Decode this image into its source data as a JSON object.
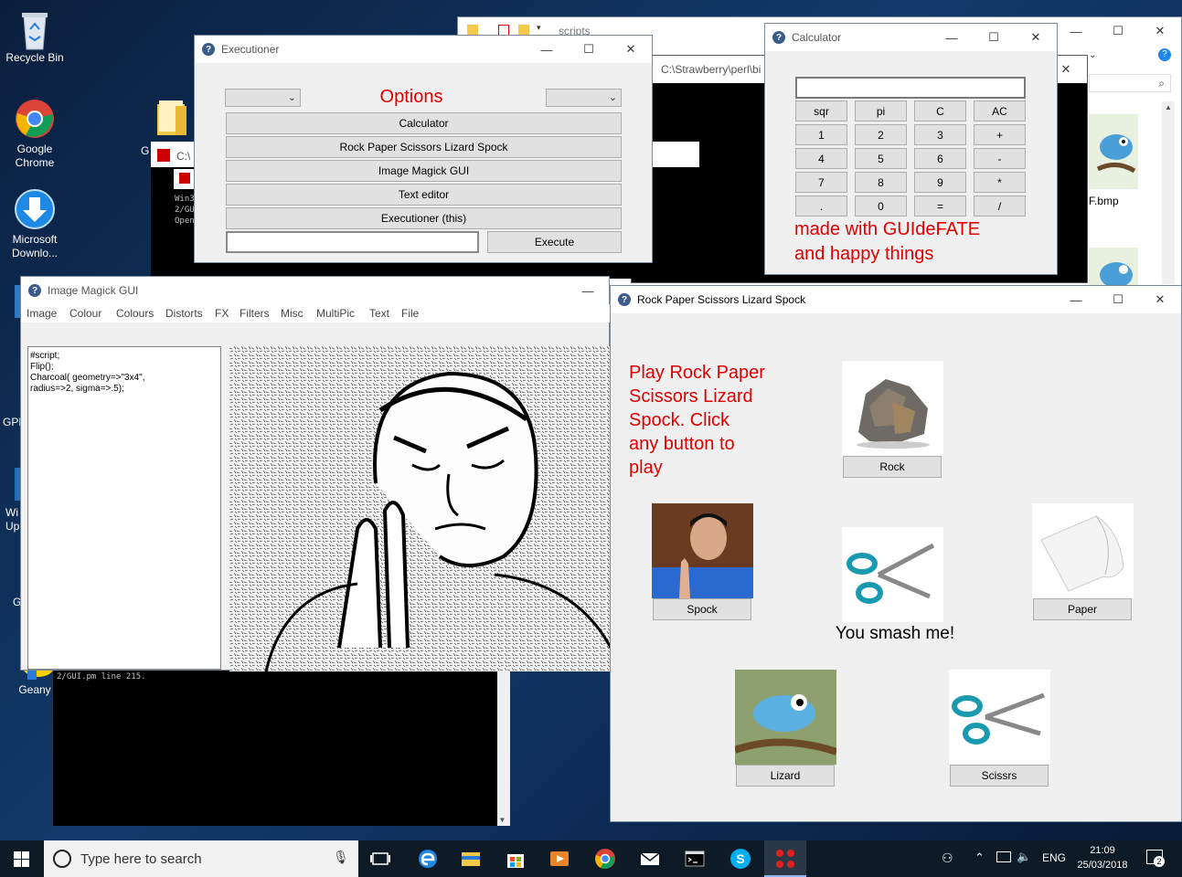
{
  "desktop": {
    "icons": [
      {
        "label": "Recycle Bin",
        "icon": "recycle-bin-icon"
      },
      {
        "label": "Google Chrome",
        "icon": "chrome-icon"
      },
      {
        "label": "Microsoft Downlo...",
        "icon": "download-arrow-icon"
      },
      {
        "label": "Geany",
        "icon": "geany-icon"
      }
    ],
    "partial_labels": [
      "G",
      "GPL",
      "Wi",
      "Up",
      "G"
    ]
  },
  "explorer": {
    "title": "scripts",
    "file1": "F.bmp"
  },
  "console_back": {
    "title": "C:\\Strawberry\\perl\\bi",
    "title2": "C:\\",
    "lines": [
      "Win3",
      "2/GU",
      "Open"
    ],
    "bottom_line": "2/GUI.pm line 215."
  },
  "executioner": {
    "title": "Executioner",
    "heading": "Options",
    "buttons": [
      "Calculator",
      "Rock Paper Scissors Lizard Spock",
      "Image Magick GUI",
      "Text editor",
      "Executioner (this)"
    ],
    "execute_label": "Execute",
    "command_value": ""
  },
  "calculator": {
    "title": "Calculator",
    "display": "",
    "keys": [
      "sqr",
      "pi",
      "C",
      "AC",
      "1",
      "2",
      "3",
      "+",
      "4",
      "5",
      "6",
      "-",
      "7",
      "8",
      "9",
      "*",
      ".",
      "0",
      "=",
      "/"
    ],
    "footer_line1": "made with GUIdeFATE",
    "footer_line2": "and happy things"
  },
  "imagemagick": {
    "title": "Image Magick GUI",
    "menu": [
      "Image",
      "Colour",
      "Colours",
      "Distorts",
      "FX",
      "Filters",
      "Misc",
      "MultiPic",
      "Text",
      "File"
    ],
    "script_lines": [
      "#script;",
      "Flip();",
      "Charcoal( geometry=>\"3x4\",",
      "radius=>2, sigma=>.5);"
    ]
  },
  "rpsls": {
    "title": "Rock Paper Scissors Lizard Spock",
    "intro_lines": [
      "Play Rock Paper",
      "Scissors Lizard",
      "Spock.  Click",
      "any button to",
      "play"
    ],
    "buttons": {
      "rock": "Rock",
      "spock": "Spock",
      "paper": "Paper",
      "lizard": "Lizard",
      "scissors": "Scissrs"
    },
    "result": "You smash me!"
  },
  "taskbar": {
    "search_placeholder": "Type here to search",
    "language": "ENG",
    "time": "21:09",
    "date": "25/03/2018",
    "notification_count": "2"
  },
  "colors": {
    "accent_red": "#e00000",
    "taskbar": "#0f1a27",
    "window_bg": "#f0f0f0"
  }
}
